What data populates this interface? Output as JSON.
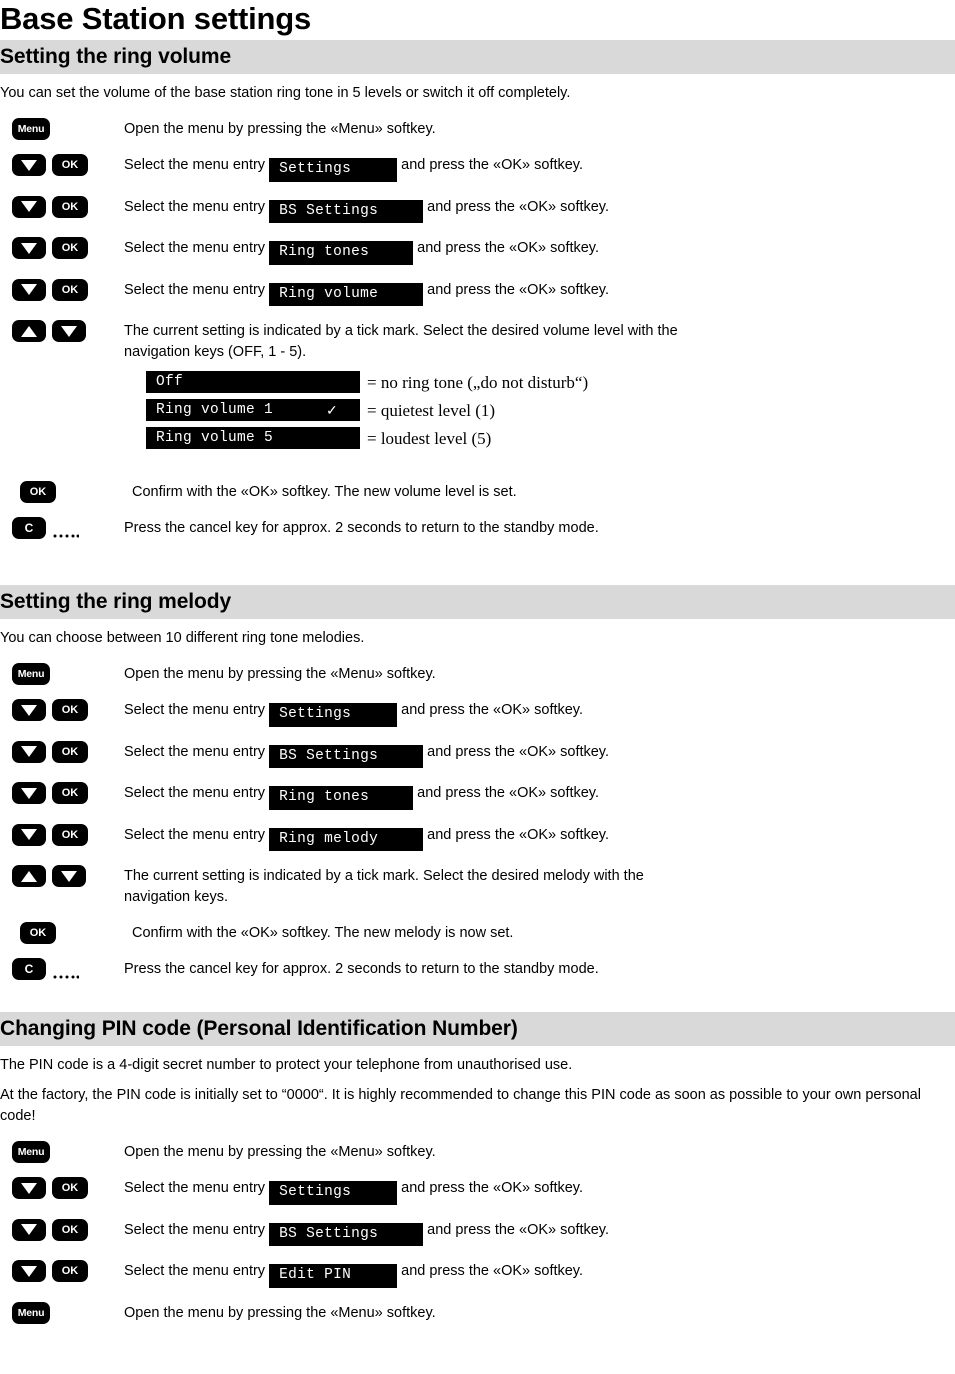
{
  "document": {
    "title": "Base Station settings"
  },
  "sections": [
    {
      "id": "ring-volume",
      "heading": "Setting the ring volume",
      "intro": "You can set the volume of the base station ring tone in 5 levels or switch it off completely.",
      "steps": [
        {
          "keys": [
            "menu"
          ],
          "text_before": "Open the menu by pressing the «Menu» softkey.",
          "lcd": null,
          "text_after": ""
        },
        {
          "keys": [
            "down",
            "ok"
          ],
          "text_before": "Select the menu entry",
          "lcd": "Settings",
          "text_after": "and press the «OK» softkey."
        },
        {
          "keys": [
            "down",
            "ok"
          ],
          "text_before": "Select the menu entry",
          "lcd": "BS Settings",
          "text_after": "and press the «OK» softkey."
        },
        {
          "keys": [
            "down",
            "ok"
          ],
          "text_before": "Select the menu entry",
          "lcd": "Ring tones",
          "text_after": "and press the «OK» softkey."
        },
        {
          "keys": [
            "down",
            "ok"
          ],
          "text_before": "Select the menu entry",
          "lcd": "Ring volume",
          "text_after": "and press the «OK» softkey."
        },
        {
          "keys": [
            "up",
            "down"
          ],
          "text_before": "The current setting is indicated by a tick mark. Select the desired volume level with the navigation keys (OFF, 1 - 5).",
          "lcd": null,
          "text_after": ""
        }
      ],
      "legend": [
        {
          "display": "Off",
          "tick": "",
          "description": "= no ring tone („do not disturb“)"
        },
        {
          "display": "Ring volume 1",
          "tick": "✓",
          "description": "= quietest level (1)"
        },
        {
          "display": "Ring volume 5",
          "tick": "",
          "description": "= loudest level (5)"
        }
      ],
      "closing_steps": [
        {
          "keys": [
            "ok"
          ],
          "text_before": "Confirm with the «OK» softkey. The new volume level is set.",
          "lcd": null,
          "text_after": ""
        },
        {
          "keys": [
            "c-hold"
          ],
          "text_before": "Press the cancel key for approx. 2 seconds to return to the standby mode.",
          "lcd": null,
          "text_after": ""
        }
      ]
    },
    {
      "id": "ring-melody",
      "heading": "Setting the ring melody",
      "intro": "You can choose between 10 different ring tone melodies.",
      "steps": [
        {
          "keys": [
            "menu"
          ],
          "text_before": "Open the menu by pressing the «Menu» softkey.",
          "lcd": null,
          "text_after": ""
        },
        {
          "keys": [
            "down",
            "ok"
          ],
          "text_before": "Select the menu entry",
          "lcd": "Settings",
          "text_after": "and press the «OK» softkey."
        },
        {
          "keys": [
            "down",
            "ok"
          ],
          "text_before": "Select the menu entry",
          "lcd": "BS Settings",
          "text_after": "and press the «OK» softkey."
        },
        {
          "keys": [
            "down",
            "ok"
          ],
          "text_before": "Select the menu entry",
          "lcd": "Ring tones",
          "text_after": "and press the «OK» softkey."
        },
        {
          "keys": [
            "down",
            "ok"
          ],
          "text_before": "Select the menu entry",
          "lcd": "Ring melody",
          "text_after": "and press the «OK» softkey."
        },
        {
          "keys": [
            "up",
            "down"
          ],
          "text_before": "The current setting is indicated by a tick mark. Select the desired melody with the navigation keys.",
          "lcd": null,
          "text_after": ""
        },
        {
          "keys": [
            "ok"
          ],
          "text_before": "Confirm with the «OK» softkey. The new melody is now set.",
          "lcd": null,
          "text_after": ""
        },
        {
          "keys": [
            "c-hold"
          ],
          "text_before": "Press the cancel key for approx. 2 seconds to return to the standby mode.",
          "lcd": null,
          "text_after": ""
        }
      ]
    },
    {
      "id": "pin-code",
      "heading": "Changing PIN code (Personal Identification Number)",
      "intro": "The PIN code is a 4-digit secret number to protect your telephone from unauthorised use.",
      "intro2": "At the factory, the PIN code is initially set to “0000“. It is highly recommended to change this PIN code as soon as possible to your own personal code!",
      "steps": [
        {
          "keys": [
            "menu"
          ],
          "text_before": "Open the menu by pressing the «Menu» softkey.",
          "lcd": null,
          "text_after": ""
        },
        {
          "keys": [
            "down",
            "ok"
          ],
          "text_before": "Select the menu entry",
          "lcd": "Settings",
          "text_after": "and press the «OK» softkey."
        },
        {
          "keys": [
            "down",
            "ok"
          ],
          "text_before": "Select the menu entry",
          "lcd": "BS Settings",
          "text_after": "and press the «OK» softkey."
        },
        {
          "keys": [
            "down",
            "ok"
          ],
          "text_before": "Select the menu entry",
          "lcd": "Edit PIN",
          "text_after": "and press the «OK» softkey."
        },
        {
          "keys": [
            "menu"
          ],
          "text_before": "Open the menu by pressing the «Menu» softkey.",
          "lcd": null,
          "text_after": ""
        }
      ]
    }
  ],
  "key_labels": {
    "menu": "Menu",
    "ok": "OK",
    "cancel": "C"
  },
  "colors": {
    "band": "#d9d9d9",
    "key": "#000000",
    "lcd_bg": "#000000",
    "lcd_fg": "#ffffff"
  }
}
